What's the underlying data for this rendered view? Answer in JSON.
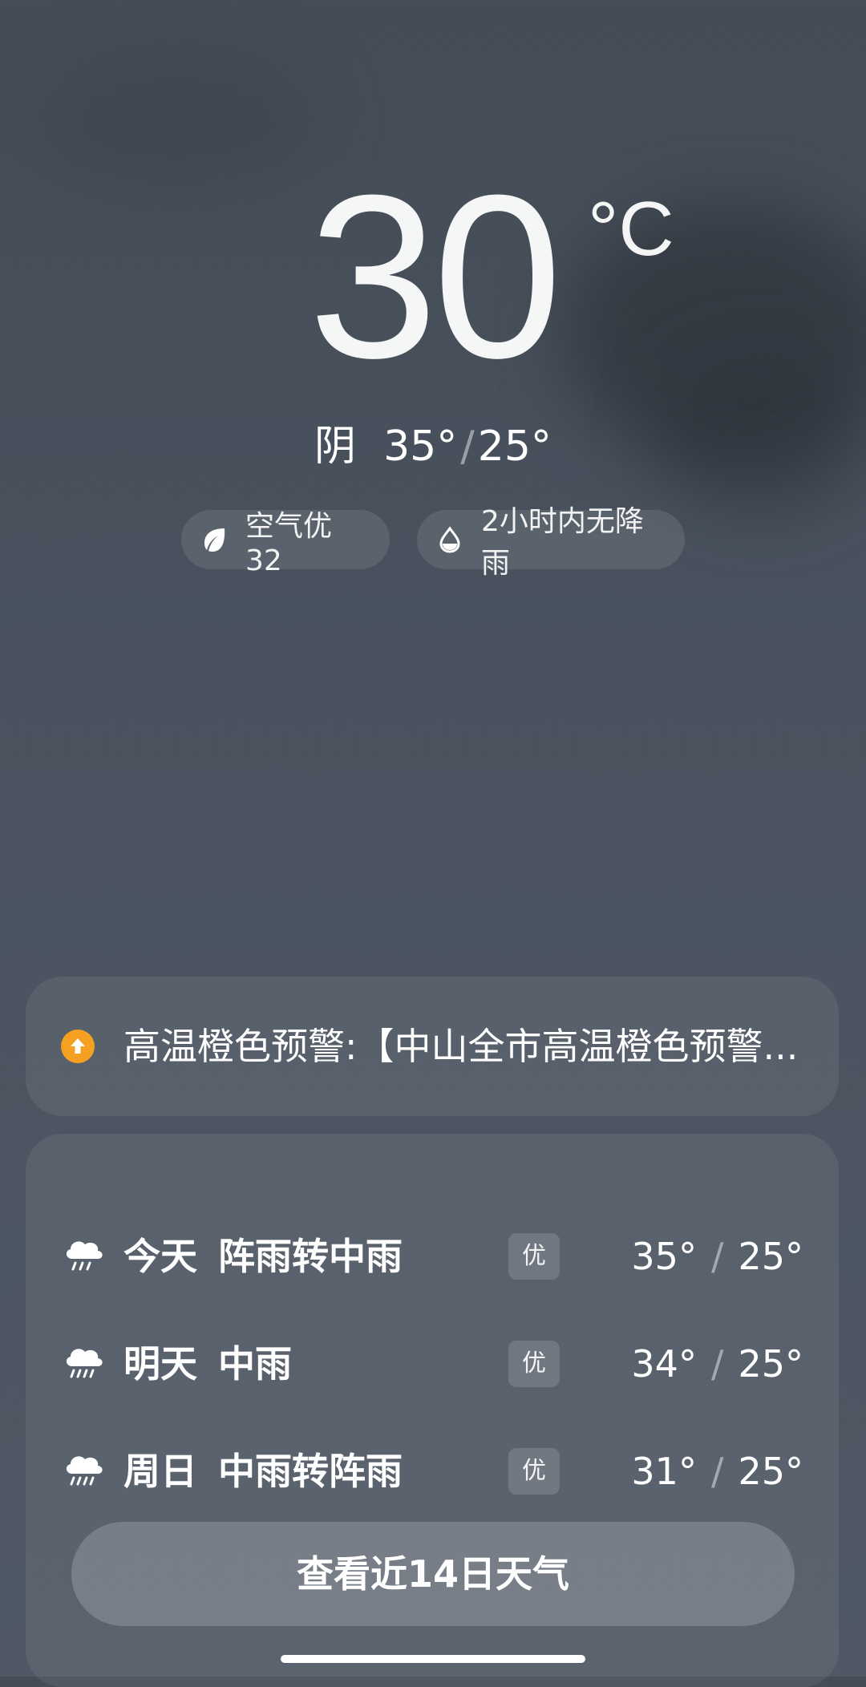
{
  "current": {
    "temperature": "30",
    "unit": "°C",
    "condition": "阴",
    "high": "35°",
    "low": "25°",
    "separator": "/"
  },
  "chips": {
    "air_quality": "空气优 32",
    "air_icon": "leaf-icon",
    "rain": "2小时内无降雨",
    "rain_icon": "water-drop-icon"
  },
  "alert": {
    "icon": "arrow-up-circle-icon",
    "color": "#f5a020",
    "text": "高温橙色预警:【中山全市高温橙色预警..."
  },
  "forecast": [
    {
      "day": "今天",
      "desc": "阵雨转中雨",
      "aqi": "优",
      "high": "35°",
      "low": "25°",
      "icon": "rain-cloud-icon"
    },
    {
      "day": "明天",
      "desc": "中雨",
      "aqi": "优",
      "high": "34°",
      "low": "25°",
      "icon": "rain-cloud-icon"
    },
    {
      "day": "周日",
      "desc": "中雨转阵雨",
      "aqi": "优",
      "high": "31°",
      "low": "25°",
      "icon": "rain-cloud-icon"
    }
  ],
  "button": {
    "label": "查看近14日天气"
  }
}
